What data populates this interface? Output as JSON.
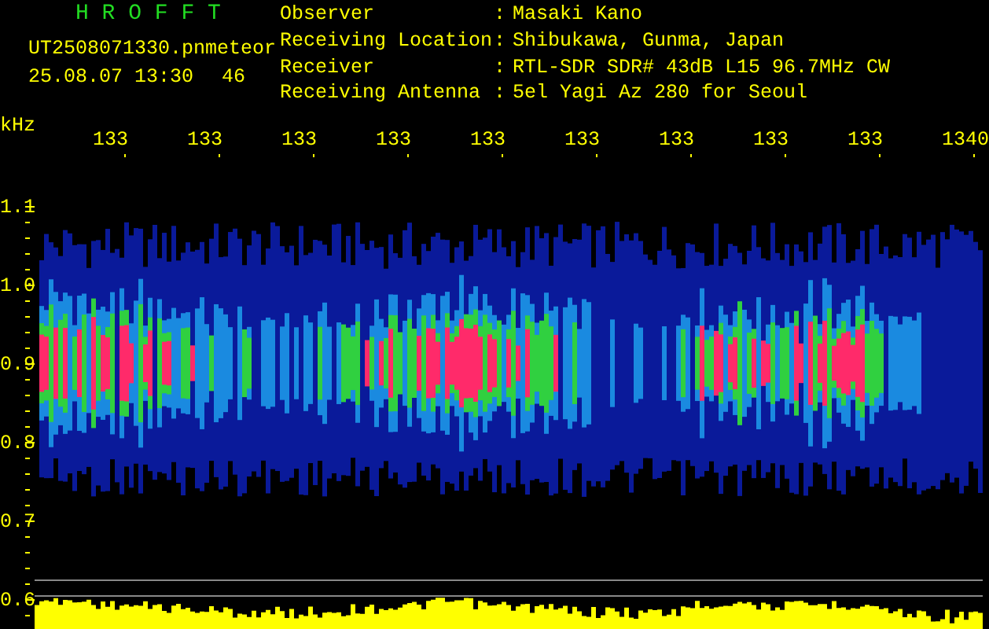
{
  "header": {
    "title": "H R O F F T",
    "file_name": "UT2508071330.pn",
    "meteor_label": "meteor",
    "date_time": "25.08.07 13:30",
    "meteor_count": "46"
  },
  "info": [
    {
      "label": "Observer",
      "separator": ":",
      "value": "Masaki Kano"
    },
    {
      "label": "Receiving Location",
      "separator": ":",
      "value": "Shibukawa, Gunma, Japan"
    },
    {
      "label": "Receiver",
      "separator": ":",
      "value": "RTL-SDR SDR# 43dB L15 96.7MHz CW"
    },
    {
      "label": "Receiving Antenna",
      "separator": ":",
      "value": "5el Yagi Az 280 for Seoul"
    }
  ],
  "axes": {
    "y_unit": "kHz",
    "y_labels": [
      "1.1",
      "1.0",
      "0.9",
      "0.8",
      "0.7",
      "0.6"
    ],
    "x_labels": [
      "133",
      "133",
      "133",
      "133",
      "133",
      "133",
      "133",
      "133",
      "133",
      "1340"
    ]
  }
}
